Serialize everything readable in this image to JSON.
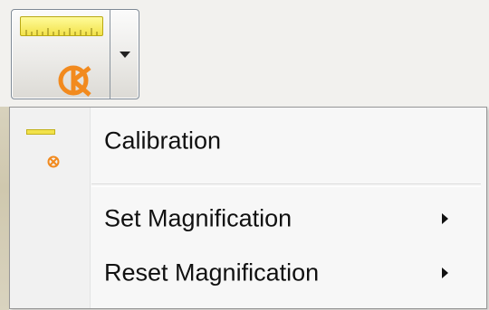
{
  "toolbar": {
    "calibration_button": {
      "icon": "ruler-calibration-icon",
      "dropdown_icon": "chevron-down-icon"
    }
  },
  "menu": {
    "items": [
      {
        "label": "Calibration",
        "icon": "ruler-calibration-icon",
        "has_submenu": false
      },
      {
        "label": "Set Magnification",
        "has_submenu": true
      },
      {
        "label": "Reset Magnification",
        "has_submenu": true
      }
    ]
  },
  "colors": {
    "ruler_yellow": "#f2e24a",
    "calibration_orange": "#f28a1e",
    "menu_background": "#f7f7f7",
    "menu_border": "#979797"
  }
}
